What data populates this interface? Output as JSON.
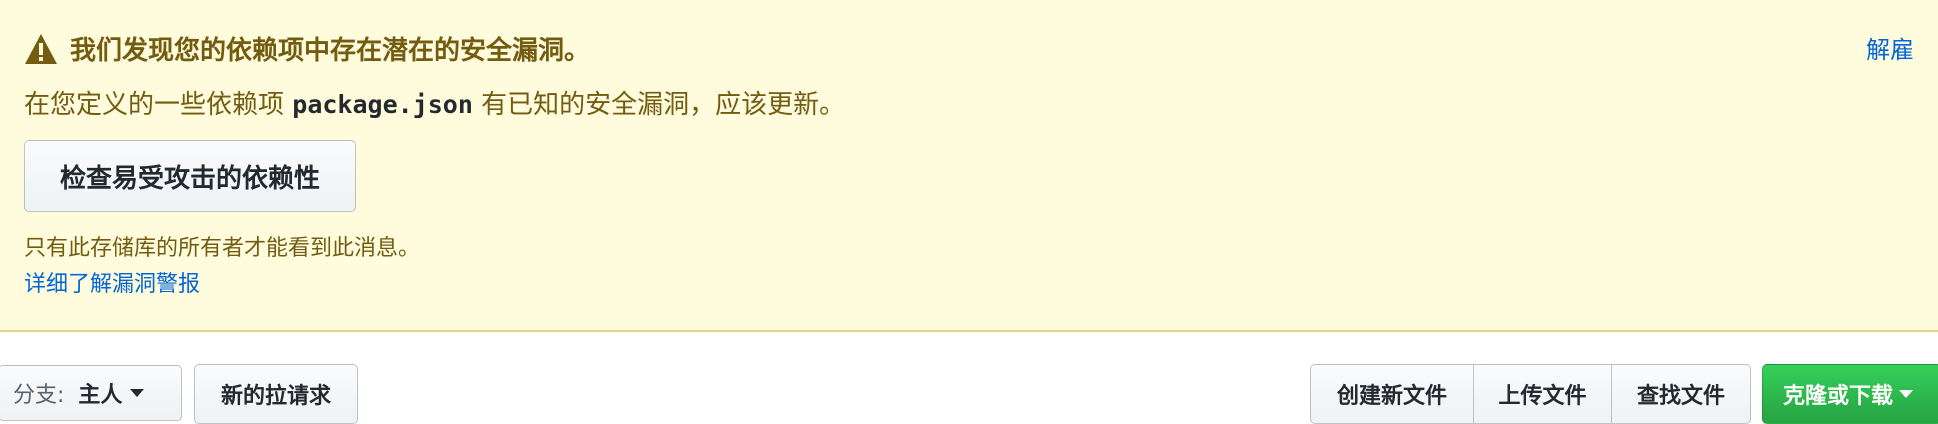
{
  "alert": {
    "title": "我们发现您的依赖项中存在潜在的安全漏洞。",
    "dismiss_label": "解雇",
    "desc_before": "在您定义的一些依赖项",
    "desc_code": "package.json",
    "desc_after": "有已知的安全漏洞，应该更新。",
    "review_button_label": "检查易受攻击的依赖性",
    "owner_note": "只有此存储库的所有者才能看到此消息。",
    "learn_more_label": "详细了解漏洞警报",
    "icon": "alert-triangle-icon",
    "colors": {
      "background": "#fffbdd",
      "text": "#735c0f",
      "link": "#0366d6"
    }
  },
  "toolbar": {
    "branch_label": "分支:",
    "branch_value": "主人",
    "new_pr_label": "新的拉请求",
    "create_file_label": "创建新文件",
    "upload_files_label": "上传文件",
    "find_file_label": "查找文件",
    "clone_label": "克隆或下载",
    "clone_color": "#28a745"
  }
}
